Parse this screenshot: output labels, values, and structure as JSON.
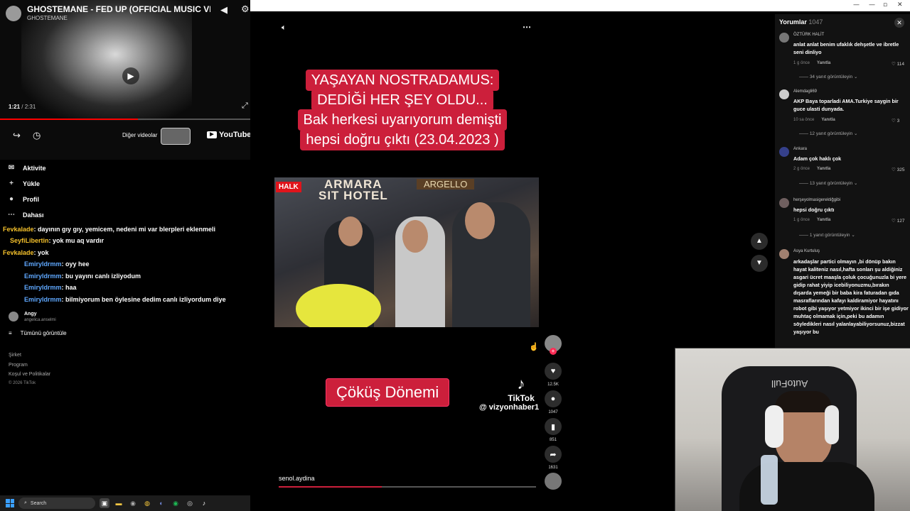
{
  "youtube": {
    "title": "GHOSTEMANE - FED UP (OFFICIAL MUSIC VIDEO)",
    "channel": "GHOSTEMANE",
    "time_current": "1:21",
    "time_total": "/ 2:31",
    "progress": 0.55,
    "more_videos": "Diğer videolar",
    "logo": "YouTube"
  },
  "menu": [
    {
      "label": "Aktivite",
      "icon": "inbox-icon",
      "glyph": "✉"
    },
    {
      "label": "Yükle",
      "icon": "plus-icon",
      "glyph": "+"
    },
    {
      "label": "Profil",
      "icon": "profile-icon",
      "glyph": "●"
    },
    {
      "label": "Dahası",
      "icon": "more-icon",
      "glyph": "⋯"
    }
  ],
  "chat": [
    {
      "name": "Fevkalade",
      "text": ": dayının gıy gıy, yemicem, nedeni mi var blerpleri eklenmeli"
    },
    {
      "name": "SeyfiLibertin",
      "text": ": yok mu aq vardır"
    },
    {
      "name": "Fevkalade",
      "text": ": yok"
    },
    {
      "name": "Emiryldrmm",
      "text": ": oyy hee"
    },
    {
      "name": "Emiryldrmm",
      "text": ": bu yayını canlı izliyodum"
    },
    {
      "name": "Emiryldrmm",
      "text": ": haa"
    },
    {
      "name": "Emiryldrmm",
      "text": ": bilmiyorum ben öylesine dedim canlı izliyordum diye"
    }
  ],
  "sidebar_user": {
    "name": "Angy",
    "handle": "angelica.anselmi"
  },
  "see_all": "Tümünü görüntüle",
  "footer": [
    "Şirket",
    "Program",
    "Koşul ve Politikalar",
    "© 2026 TikTok"
  ],
  "video": {
    "banner_lines": [
      "YAŞAYAN NOSTRADAMUS:",
      "DEDİĞİ HER ŞEY OLDU...",
      "Bak herkesi uyarıyorum demişti",
      "hepsi doğru çıktı (23.04.2023 )"
    ],
    "bottom_caption": "Çöküş Dönemi",
    "tiktok_word": "TikTok",
    "tiktok_handle": "@ vizyonhaber1",
    "sign_text": "ARMARA",
    "sign_text2": "SIT HOTEL",
    "shop_sign": "ARGELLO",
    "halk": "HALK",
    "username": "senol.aydina",
    "likes": "12.5K",
    "comments": "1047",
    "saves": "851",
    "shares": "1631",
    "progress": 0.4
  },
  "comments_panel": {
    "title": "Yorumlar",
    "count": "1047",
    "reply_label": "Yanıtla",
    "items": [
      {
        "user": "ÖZTÜRK HALİT",
        "text": "anlat anlat benim ufaklık dehşetle ve ibretle seni dinliyo",
        "time": "1 g önce",
        "likes": "114",
        "replies": "34 yanıt görüntüleyin"
      },
      {
        "user": "Alemdagli69",
        "text": "AKP Baya toparladi AMA.Turkiye saygin bir guce ulasti dunyada.",
        "time": "10 sa önce",
        "likes": "3",
        "replies": "12 yanıt görüntüleyin"
      },
      {
        "user": "Ankara",
        "text": "Adam çok haklı çok",
        "time": "2 g önce",
        "likes": "325",
        "replies": "13 yanıt görüntüleyin"
      },
      {
        "user": "herşeyolmasigerektiğgibi",
        "text": "hepsi doğru çıktı",
        "time": "1 g önce",
        "likes": "127",
        "replies": "1 yanıt görüntüleyin"
      },
      {
        "user": "Asya Kurtuluş",
        "text": "arkadaşlar partici olmayın ,bi dönüp bakın hayat kaliteniz nasıl,hafta sonları şu aldiğiniz asgari ücret maaşla çoluk çocuğunuzla bi yere gidip rahat yiyip icebiliyonuzmu,bırakın dışarda yemeği bir baba kira faturadan gıda masraflarından kafayı kaldiramiyor hayatını robot gibi yaşıyor yetmiyor ikinci bir işe gidiyor muhtaç olmamak için,peki bu adamın söyledikleri nasıl yalanlayabiliyorsunuz,bizzat yaşıyor bu"
      }
    ]
  },
  "webcam": {
    "chair_text": "AutoFull"
  },
  "taskbar": {
    "search": "Search"
  },
  "colors": {
    "accent_red": "#cc1f3b",
    "youtube_red": "#ff0000",
    "chat_name": "#f5c12b",
    "chat_name_alt": "#5fa8ff"
  }
}
